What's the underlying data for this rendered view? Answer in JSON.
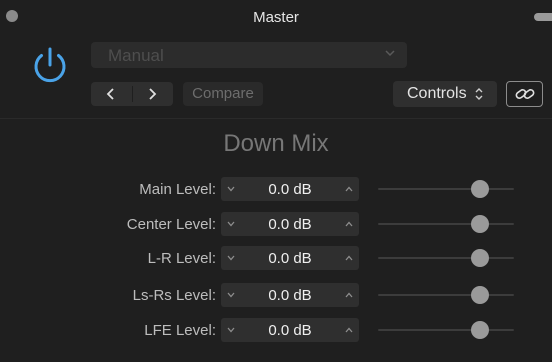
{
  "window": {
    "title": "Master"
  },
  "header": {
    "preset_value": "Manual",
    "compare_label": "Compare",
    "view_select_label": "Controls"
  },
  "plugin": {
    "title": "Down Mix",
    "rows": [
      {
        "label": "Main Level:",
        "value": "0.0 dB",
        "slider": 0.75
      },
      {
        "label": "Center Level:",
        "value": "0.0 dB",
        "slider": 0.75
      },
      {
        "label": "L-R Level:",
        "value": "0.0 dB",
        "slider": 0.75
      },
      {
        "label": "Ls-Rs Level:",
        "value": "0.0 dB",
        "slider": 0.75
      },
      {
        "label": "LFE Level:",
        "value": "0.0 dB",
        "slider": 0.75
      }
    ]
  },
  "colors": {
    "accent": "#4aa3e8",
    "background": "#1f1f1f"
  },
  "icons": [
    "power-icon",
    "chevron-down-icon",
    "chevron-left-icon",
    "chevron-right-icon",
    "up-down-chevron-icon",
    "link-icon"
  ]
}
